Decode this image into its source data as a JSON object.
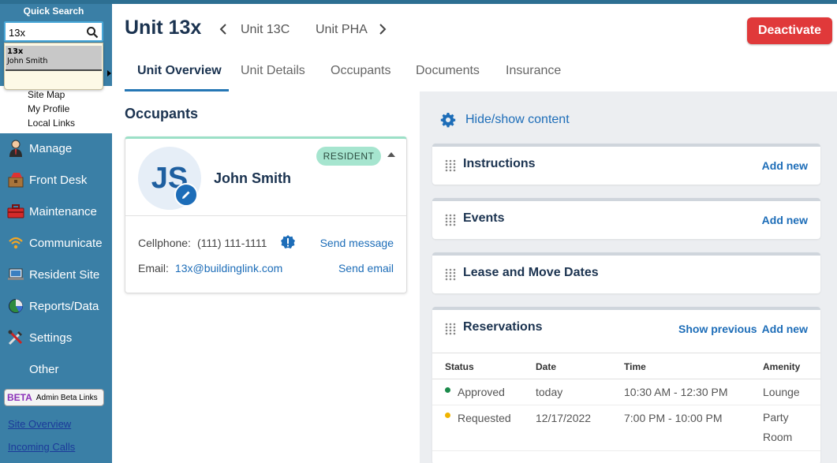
{
  "sidebar": {
    "quick_search_title": "Quick Search",
    "search_value": "13x",
    "dropdown_result": {
      "unit": "13x",
      "name": "John Smith"
    },
    "links": [
      "Site Map",
      "My Profile",
      "Local Links"
    ],
    "nav": [
      {
        "label": "Manage",
        "icon": "user-tie-icon"
      },
      {
        "label": "Front Desk",
        "icon": "package-icon"
      },
      {
        "label": "Maintenance",
        "icon": "toolbox-icon"
      },
      {
        "label": "Communicate",
        "icon": "wifi-icon"
      },
      {
        "label": "Resident Site",
        "icon": "laptop-icon"
      },
      {
        "label": "Reports/Data",
        "icon": "pie-chart-icon"
      },
      {
        "label": "Settings",
        "icon": "tools-icon"
      },
      {
        "label": "Other",
        "icon": ""
      }
    ],
    "beta_badge": "BETA",
    "beta_label": "Admin Beta Links",
    "bottom_links": [
      "Site Overview",
      "Incoming Calls"
    ]
  },
  "header": {
    "unit_title": "Unit 13x",
    "prev_unit": "Unit 13C",
    "next_unit": "Unit PHA",
    "deactivate_label": "Deactivate"
  },
  "tabs": [
    "Unit Overview",
    "Unit Details",
    "Occupants",
    "Documents",
    "Insurance"
  ],
  "active_tab": "Unit Overview",
  "occupants": {
    "heading": "Occupants",
    "card": {
      "initials": "JS",
      "name": "John Smith",
      "badge": "RESIDENT",
      "cell_label": "Cellphone:",
      "cell_value": "(111) 111-1111",
      "send_message": "Send message",
      "email_label": "Email:",
      "email_value": "13x@buildinglink.com",
      "send_email": "Send email"
    }
  },
  "panel": {
    "hide_show": "Hide/show content",
    "cards": {
      "instructions": {
        "title": "Instructions",
        "add": "Add new"
      },
      "events": {
        "title": "Events",
        "add": "Add new"
      },
      "lease": {
        "title": "Lease and Move Dates"
      },
      "reservations": {
        "title": "Reservations",
        "show_previous": "Show previous",
        "add": "Add new",
        "columns": [
          "Status",
          "Date",
          "Time",
          "Amenity"
        ],
        "rows": [
          {
            "status": "Approved",
            "status_color": "#1a8a4a",
            "date": "today",
            "time": "10:30 AM - 12:30 PM",
            "amenity": "Lounge"
          },
          {
            "status": "Requested",
            "status_color": "#f0b400",
            "date": "12/17/2022",
            "time": "7:00 PM - 10:00 PM",
            "amenity": "Party Room"
          }
        ]
      }
    }
  },
  "colors": {
    "sidebar": "#3a7fa6",
    "accent": "#1d6db8",
    "deactivate": "#e0393a",
    "resident_badge": "#a6e5cf"
  }
}
